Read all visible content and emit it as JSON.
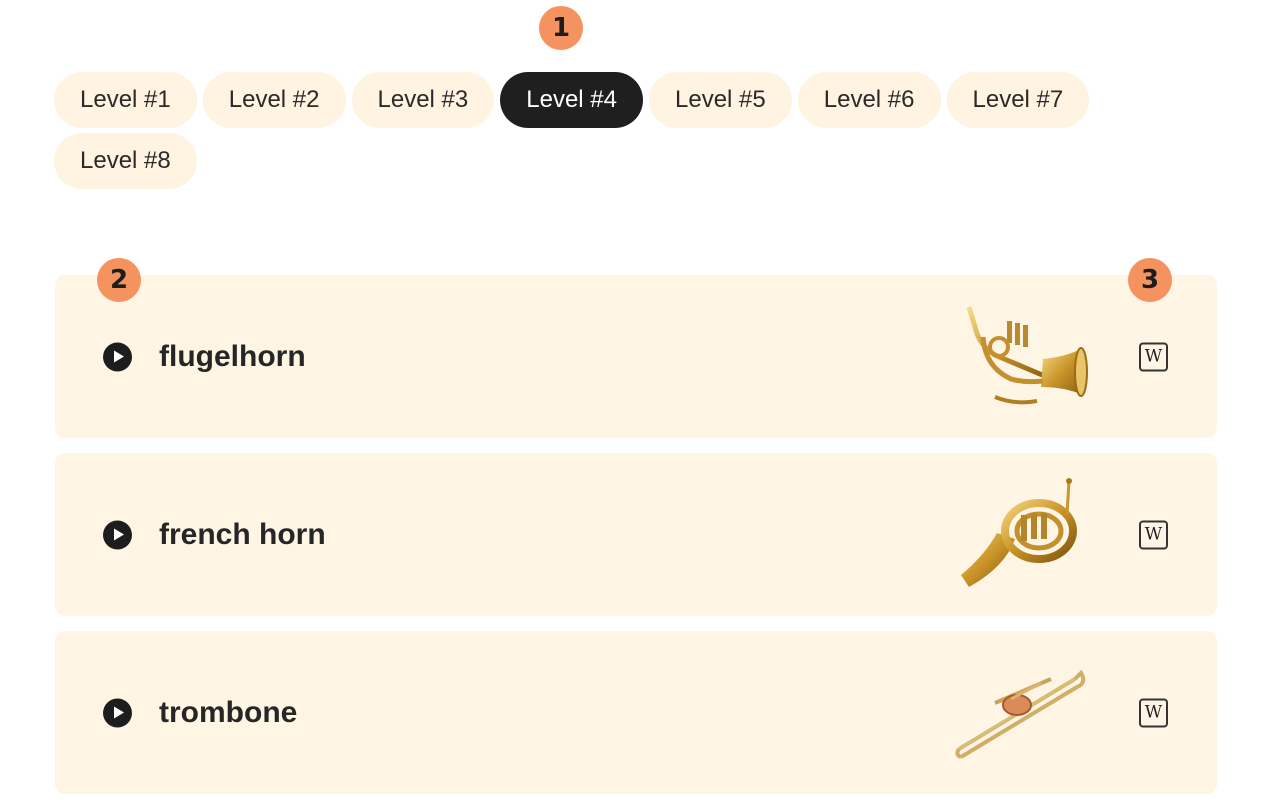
{
  "markers": [
    "1",
    "2",
    "3"
  ],
  "levels": [
    {
      "label": "Level #1"
    },
    {
      "label": "Level #2"
    },
    {
      "label": "Level #3"
    },
    {
      "label": "Level #4"
    },
    {
      "label": "Level #5"
    },
    {
      "label": "Level #6"
    },
    {
      "label": "Level #7"
    },
    {
      "label": "Level #8"
    }
  ],
  "active_level": "Level #4",
  "instruments": [
    {
      "name": "flugelhorn",
      "play_icon": "play-icon",
      "image": "flugelhorn-image",
      "link_icon": "wikipedia-icon",
      "link_label": "W"
    },
    {
      "name": "french horn",
      "play_icon": "play-icon",
      "image": "french-horn-image",
      "link_icon": "wikipedia-icon",
      "link_label": "W"
    },
    {
      "name": "trombone",
      "play_icon": "play-icon",
      "image": "trombone-image",
      "link_icon": "wikipedia-icon",
      "link_label": "W"
    }
  ],
  "colors": {
    "chip_bg": "#fff3e1",
    "chip_active_bg": "#1f1f1f",
    "card_bg": "#fff5e5",
    "marker": "#f4935f"
  }
}
